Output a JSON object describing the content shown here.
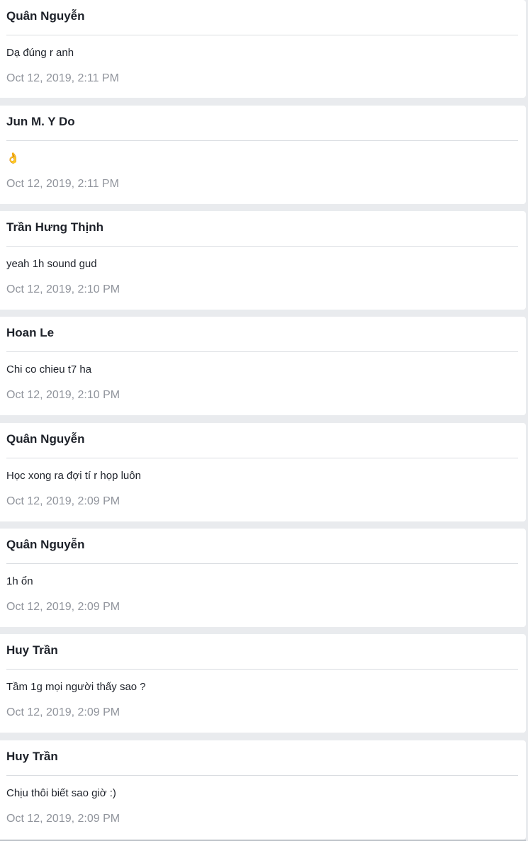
{
  "messages": [
    {
      "author": "Quân Nguyễn",
      "text": "Dạ đúng r anh",
      "time": "Oct 12, 2019, 2:11 PM"
    },
    {
      "author": "Jun M. Y Do",
      "text": "👌",
      "time": "Oct 12, 2019, 2:11 PM"
    },
    {
      "author": "Trần Hưng Thịnh",
      "text": "yeah 1h sound gud",
      "time": "Oct 12, 2019, 2:10 PM"
    },
    {
      "author": "Hoan Le",
      "text": "Chi co chieu t7 ha",
      "time": "Oct 12, 2019, 2:10 PM"
    },
    {
      "author": "Quân Nguyễn",
      "text": "Học xong ra đợi tí r họp luôn",
      "time": "Oct 12, 2019, 2:09 PM"
    },
    {
      "author": "Quân Nguyễn",
      "text": "1h ổn",
      "time": "Oct 12, 2019, 2:09 PM"
    },
    {
      "author": "Huy Trần",
      "text": "Tầm 1g mọi người thấy sao ?",
      "time": "Oct 12, 2019, 2:09 PM"
    },
    {
      "author": "Huy Trần",
      "text": "Chịu thôi biết sao giờ :)",
      "time": "Oct 12, 2019, 2:09 PM"
    }
  ]
}
